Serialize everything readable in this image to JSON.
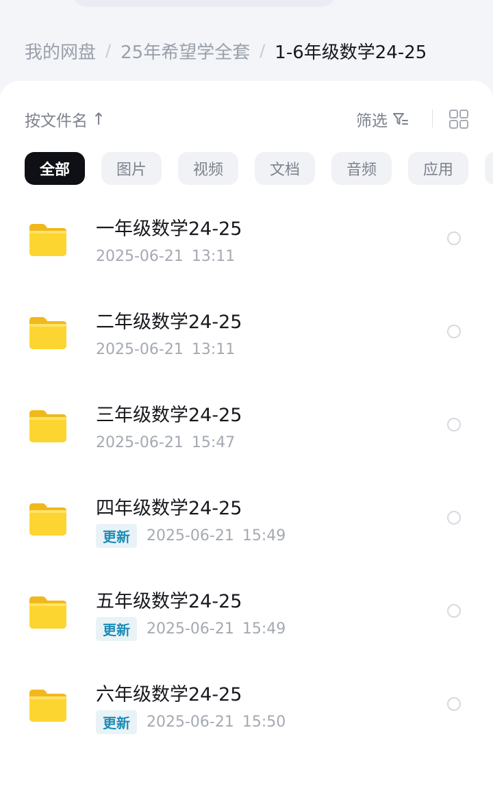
{
  "breadcrumb": {
    "items": [
      "我的网盘",
      "25年希望学全套"
    ],
    "current": "1-6年级数学24-25",
    "separator": "/"
  },
  "toolbar": {
    "sort_label": "按文件名",
    "sort_arrow": "↑",
    "filter_label": "筛选",
    "grid_icon": "grid-view-icon",
    "filter_icon": "filter-icon"
  },
  "chips": [
    "全部",
    "图片",
    "视频",
    "文档",
    "音频",
    "应用"
  ],
  "files": [
    {
      "name": "一年级数学24-25",
      "badge": "",
      "date": "2025-06-21",
      "time": "13:11"
    },
    {
      "name": "二年级数学24-25",
      "badge": "",
      "date": "2025-06-21",
      "time": "13:11"
    },
    {
      "name": "三年级数学24-25",
      "badge": "",
      "date": "2025-06-21",
      "time": "15:47"
    },
    {
      "name": "四年级数学24-25",
      "badge": "更新",
      "date": "2025-06-21",
      "time": "15:49"
    },
    {
      "name": "五年级数学24-25",
      "badge": "更新",
      "date": "2025-06-21",
      "time": "15:49"
    },
    {
      "name": "六年级数学24-25",
      "badge": "更新",
      "date": "2025-06-21",
      "time": "15:50"
    }
  ],
  "colors": {
    "folder": "#fdd530",
    "active_chip": "#0f1016",
    "badge_text": "#1d8cb8"
  }
}
